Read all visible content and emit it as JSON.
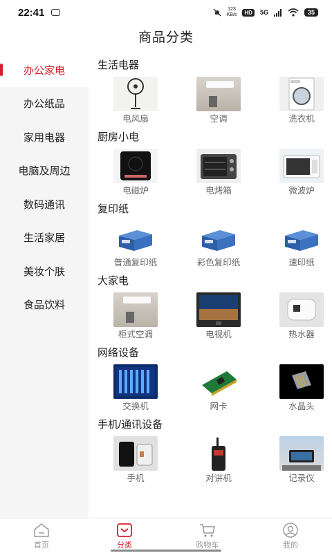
{
  "status": {
    "time": "22:41",
    "speed_value": "123",
    "speed_unit": "KB/s",
    "hd": "HD",
    "network": "5G",
    "battery": "35"
  },
  "page_title": "商品分类",
  "sidebar": {
    "items": [
      {
        "label": "办公家电",
        "active": true
      },
      {
        "label": "办公纸品"
      },
      {
        "label": "家用电器"
      },
      {
        "label": "电脑及周边"
      },
      {
        "label": "数码通讯"
      },
      {
        "label": "生活家居"
      },
      {
        "label": "美妆个肤"
      },
      {
        "label": "食品饮料"
      }
    ]
  },
  "sections": [
    {
      "title": "生活电器",
      "items": [
        {
          "label": "电风扇",
          "icon": "fan-photo"
        },
        {
          "label": "空调",
          "icon": "air-conditioner-photo"
        },
        {
          "label": "洗衣机",
          "icon": "washing-machine-photo"
        }
      ]
    },
    {
      "title": "厨房小电",
      "items": [
        {
          "label": "电磁炉",
          "icon": "induction-cooker-photo"
        },
        {
          "label": "电烤箱",
          "icon": "oven-photo"
        },
        {
          "label": "微波炉",
          "icon": "microwave-photo"
        }
      ]
    },
    {
      "title": "复印纸",
      "items": [
        {
          "label": "普通复印纸",
          "icon": "paper-box-photo"
        },
        {
          "label": "彩色复印纸",
          "icon": "paper-box-photo"
        },
        {
          "label": "速印纸",
          "icon": "paper-box-photo"
        }
      ]
    },
    {
      "title": "大家电",
      "items": [
        {
          "label": "柜式空调",
          "icon": "cabinet-ac-photo"
        },
        {
          "label": "电视机",
          "icon": "tv-photo"
        },
        {
          "label": "热水器",
          "icon": "water-heater-photo"
        }
      ]
    },
    {
      "title": "网络设备",
      "items": [
        {
          "label": "交换机",
          "icon": "switch-photo"
        },
        {
          "label": "网卡",
          "icon": "network-card-photo"
        },
        {
          "label": "水晶头",
          "icon": "rj45-photo"
        }
      ]
    },
    {
      "title": "手机/通讯设备",
      "items": [
        {
          "label": "手机",
          "icon": "phone-photo"
        },
        {
          "label": "对讲机",
          "icon": "walkie-talkie-photo"
        },
        {
          "label": "记录仪",
          "icon": "dashcam-photo"
        }
      ]
    }
  ],
  "bottom_nav": [
    {
      "label": "首页",
      "icon": "home-icon"
    },
    {
      "label": "分类",
      "icon": "category-icon",
      "active": true
    },
    {
      "label": "购物车",
      "icon": "cart-icon"
    },
    {
      "label": "我的",
      "icon": "profile-icon"
    }
  ],
  "colors": {
    "accent": "#d91e2b",
    "sidebar_bg": "#f5f5f5"
  }
}
